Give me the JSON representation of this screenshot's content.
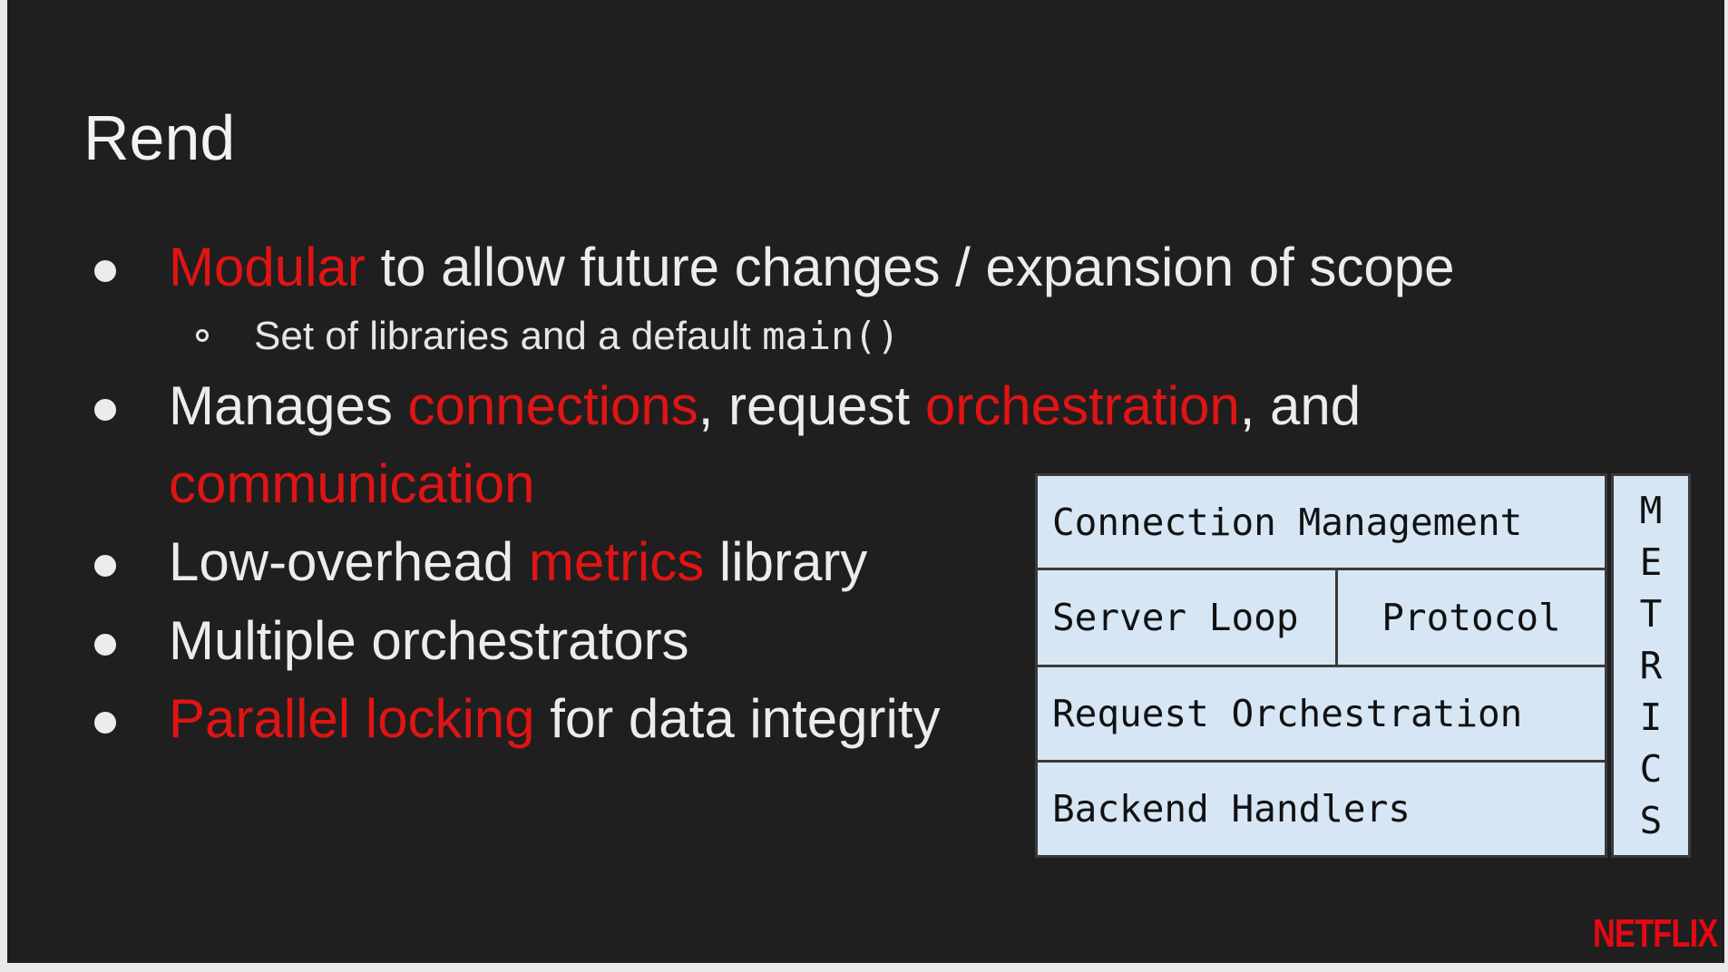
{
  "slide": {
    "title": "Rend",
    "bullets": [
      {
        "parts": [
          {
            "text": "Modular",
            "highlight": true
          },
          {
            "text": " to allow future changes / expansion of scope",
            "highlight": false
          }
        ]
      },
      {
        "parts": [
          {
            "text": "Manages ",
            "highlight": false
          },
          {
            "text": "connections",
            "highlight": true
          },
          {
            "text": ", request ",
            "highlight": false
          },
          {
            "text": "orchestration",
            "highlight": true
          },
          {
            "text": ", and",
            "highlight": false
          }
        ],
        "continuation": {
          "text": "communication",
          "highlight": true
        }
      },
      {
        "parts": [
          {
            "text": "Low-overhead ",
            "highlight": false
          },
          {
            "text": "metrics",
            "highlight": true
          },
          {
            "text": " library",
            "highlight": false
          }
        ]
      },
      {
        "parts": [
          {
            "text": "Multiple orchestrators",
            "highlight": false
          }
        ]
      },
      {
        "parts": [
          {
            "text": "Parallel locking",
            "highlight": true
          },
          {
            "text": " for data integrity",
            "highlight": false
          }
        ]
      }
    ],
    "sub_bullet": {
      "text": "Set of libraries and a default ",
      "code": "main()"
    }
  },
  "diagram": {
    "connection_management": "Connection Management",
    "server_loop": "Server Loop",
    "protocol": "Protocol",
    "request_orchestration": "Request Orchestration",
    "backend_handlers": "Backend Handlers",
    "metrics_letters": [
      "M",
      "E",
      "T",
      "R",
      "I",
      "C",
      "S"
    ]
  },
  "logo": "NETFLIX",
  "colors": {
    "background": "#1f1f1f",
    "text": "#ececec",
    "highlight": "#e01414",
    "box_fill": "#d6e6f4",
    "logo": "#e50914"
  }
}
